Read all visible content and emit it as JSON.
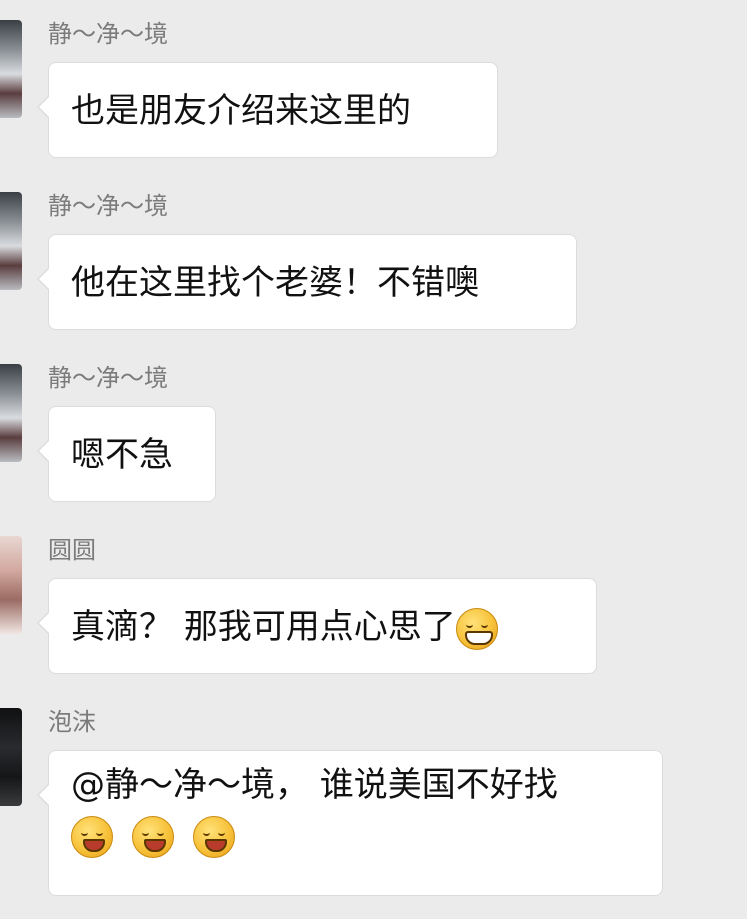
{
  "messages": [
    {
      "sender": "静～净～境",
      "text": "也是朋友介绍来这里的"
    },
    {
      "sender": "静～净～境",
      "text": "他在这里找个老婆！不错噢"
    },
    {
      "sender": "静～净～境",
      "text": "嗯不急"
    },
    {
      "sender": "圆圆",
      "text": "真滴？ 那我可用点心思了",
      "emoji": "grinning-emoji"
    },
    {
      "sender": "泡沫",
      "text": "@静～净～境， 谁说美国不好找",
      "emoji": "winking-tongue-emoji"
    }
  ]
}
